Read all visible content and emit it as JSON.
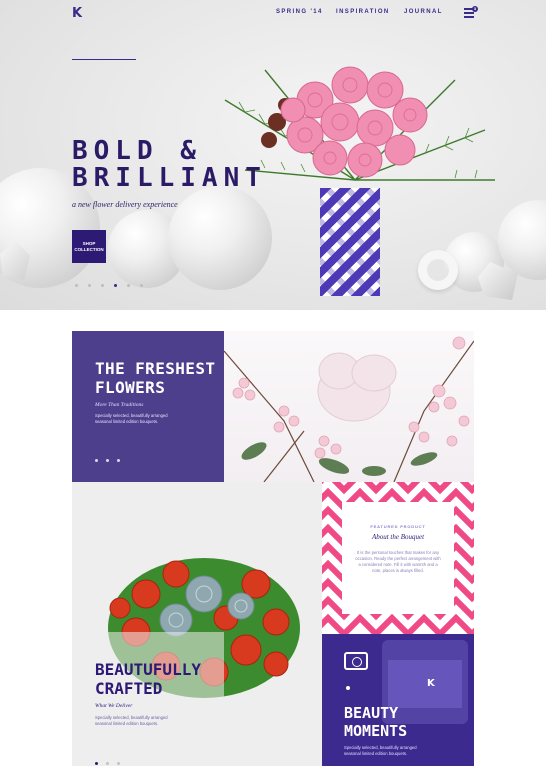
{
  "brand": {
    "logo": "K"
  },
  "nav": {
    "items": [
      "SPRING '14",
      "INSPIRATION",
      "JOURNAL"
    ],
    "menu_badge": "3"
  },
  "hero": {
    "title_line1": "BOLD &",
    "title_line2": "BRILLIANT",
    "subtitle": "a new flower delivery experience",
    "button_label": "SHOP COLLECTION",
    "slides": 6,
    "active_slide": 3
  },
  "freshest": {
    "title_line1": "THE FRESHEST",
    "title_line2": "FLOWERS",
    "subtitle": "More Than Traditions",
    "body": "Specially selected, beautifully arranged seasonal limited edition bouquets."
  },
  "crafted": {
    "title_line1": "BEAUTUFULLY",
    "title_line2": "CRAFTED",
    "subtitle": "What We Deliver",
    "body": "Specially selected, beautifully arranged seasonal limited edition bouquets."
  },
  "bouquet": {
    "label": "FEATURED PRODUCT",
    "title": "About the Bouquet",
    "body": "It is the personal touches that makes for any occasion. Ready the perfect arrangement with a considered note. Fill it with warmth and a note, places is always filled."
  },
  "moments": {
    "title_line1": "BEAUTY",
    "title_line2": "MOMENTS",
    "body": "Specially selected, beautifully arranged seasonal limited edition bouquets."
  },
  "colors": {
    "brand_purple": "#2d1a75",
    "panel_purple": "#4e3f8c",
    "chevron_pink": "#ef4a86",
    "vase_blue": "#4d39b5"
  }
}
